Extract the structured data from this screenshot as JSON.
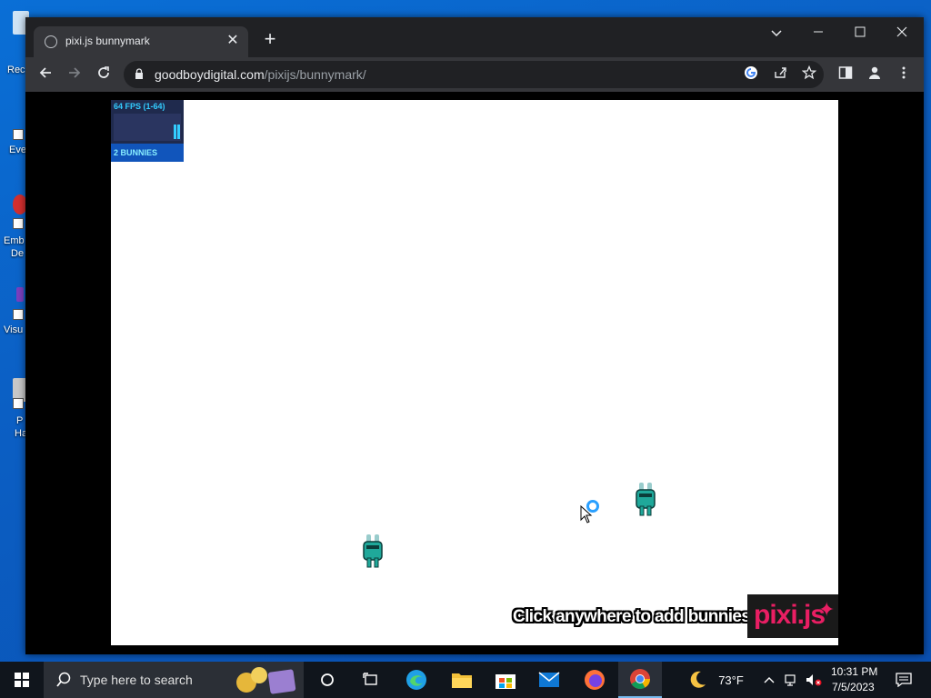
{
  "desktop": {
    "icons": [
      {
        "label": "Rec"
      },
      {
        "label": "Eve"
      },
      {
        "label": "Emb"
      },
      {
        "label": "Visu"
      },
      {
        "label": "P"
      }
    ],
    "icon_label_extra": [
      "De",
      "Ha"
    ]
  },
  "browser": {
    "tab_title": "pixi.js bunnymark",
    "tab_close": "✕",
    "new_tab": "+",
    "url_host": "goodboydigital.com",
    "url_path": "/pixijs/bunnymark/"
  },
  "page": {
    "stats": {
      "fps_label": "64 FPS (1-64)",
      "bunnies_label": "2 BUNNIES"
    },
    "cta_text": "Click anywhere to add bunnies!",
    "logo_text": "pixi.js"
  },
  "taskbar": {
    "search_placeholder": "Type here to search",
    "weather_temp": "73°F",
    "time": "10:31 PM",
    "date": "7/5/2023"
  },
  "colors": {
    "accent": "#3cf",
    "logo": "#e91e63",
    "bunny": "#1fa89a"
  }
}
